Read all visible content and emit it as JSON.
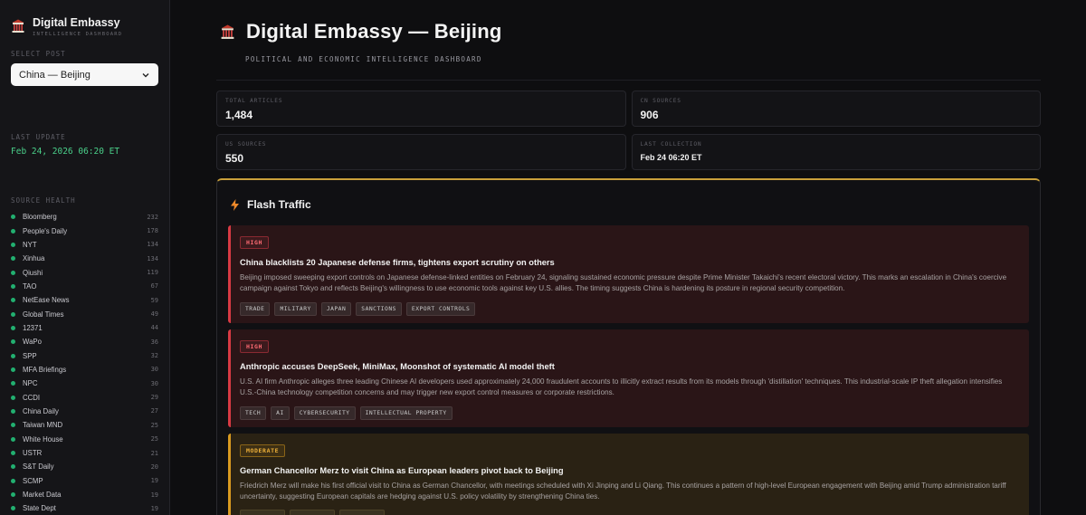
{
  "sidebar": {
    "brand_title": "Digital Embassy",
    "brand_subtitle": "INTELLIGENCE DASHBOARD",
    "select_post_label": "SELECT POST",
    "selected_post": "China — Beijing",
    "last_update_label": "LAST UPDATE",
    "last_update_value": "Feb 24, 2026 06:20 ET",
    "source_health_label": "SOURCE HEALTH",
    "sources": [
      {
        "name": "Bloomberg",
        "count": "232"
      },
      {
        "name": "People's Daily",
        "count": "178"
      },
      {
        "name": "NYT",
        "count": "134"
      },
      {
        "name": "Xinhua",
        "count": "134"
      },
      {
        "name": "Qiushi",
        "count": "119"
      },
      {
        "name": "TAO",
        "count": "67"
      },
      {
        "name": "NetEase News",
        "count": "59"
      },
      {
        "name": "Global Times",
        "count": "49"
      },
      {
        "name": "12371",
        "count": "44"
      },
      {
        "name": "WaPo",
        "count": "36"
      },
      {
        "name": "SPP",
        "count": "32"
      },
      {
        "name": "MFA Briefings",
        "count": "30"
      },
      {
        "name": "NPC",
        "count": "30"
      },
      {
        "name": "CCDI",
        "count": "29"
      },
      {
        "name": "China Daily",
        "count": "27"
      },
      {
        "name": "Taiwan MND",
        "count": "25"
      },
      {
        "name": "White House",
        "count": "25"
      },
      {
        "name": "USTR",
        "count": "21"
      },
      {
        "name": "S&T Daily",
        "count": "20"
      },
      {
        "name": "SCMP",
        "count": "19"
      },
      {
        "name": "Market Data",
        "count": "19"
      },
      {
        "name": "State Dept",
        "count": "19"
      }
    ]
  },
  "header": {
    "title": "Digital Embassy — Beijing",
    "subtitle": "POLITICAL AND ECONOMIC INTELLIGENCE DASHBOARD"
  },
  "stats": {
    "total_articles_label": "TOTAL ARTICLES",
    "total_articles_value": "1,484",
    "cn_sources_label": "CN SOURCES",
    "cn_sources_value": "906",
    "us_sources_label": "US SOURCES",
    "us_sources_value": "550",
    "last_collection_label": "LAST COLLECTION",
    "last_collection_value": "Feb 24 06:20 ET"
  },
  "flash": {
    "title": "Flash Traffic",
    "items": [
      {
        "severity": "HIGH",
        "title": "China blacklists 20 Japanese defense firms, tightens export scrutiny on others",
        "text": "Beijing imposed sweeping export controls on Japanese defense-linked entities on February 24, signaling sustained economic pressure despite Prime Minister Takaichi's recent electoral victory. This marks an escalation in China's coercive campaign against Tokyo and reflects Beijing's willingness to use economic tools against key U.S. allies. The timing suggests China is hardening its posture in regional security competition.",
        "tags": [
          "TRADE",
          "MILITARY",
          "JAPAN",
          "SANCTIONS",
          "EXPORT CONTROLS"
        ]
      },
      {
        "severity": "HIGH",
        "title": "Anthropic accuses DeepSeek, MiniMax, Moonshot of systematic AI model theft",
        "text": "U.S. AI firm Anthropic alleges three leading Chinese AI developers used approximately 24,000 fraudulent accounts to illicitly extract results from its models through 'distillation' techniques. This industrial-scale IP theft allegation intensifies U.S.-China technology competition concerns and may trigger new export control measures or corporate restrictions.",
        "tags": [
          "TECH",
          "AI",
          "CYBERSECURITY",
          "INTELLECTUAL PROPERTY"
        ]
      },
      {
        "severity": "MODERATE",
        "title": "German Chancellor Merz to visit China as European leaders pivot back to Beijing",
        "text": "Friedrich Merz will make his first official visit to China as German Chancellor, with meetings scheduled with Xi Jinping and Li Qiang. This continues a pattern of high-level European engagement with Beijing amid Trump administration tariff uncertainty, suggesting European capitals are hedging against U.S. policy volatility by strengthening China ties.",
        "tags": [
          "",
          "",
          ""
        ]
      }
    ]
  },
  "colors": {
    "accent_gold": "#c9a03a",
    "high_red": "#d83a44",
    "moderate_amber": "#d99a20",
    "health_green": "#22b070"
  },
  "icons": {
    "brand": "embassy-building-icon",
    "flash": "lightning-bolt-icon",
    "select": "chevron-down-icon"
  }
}
